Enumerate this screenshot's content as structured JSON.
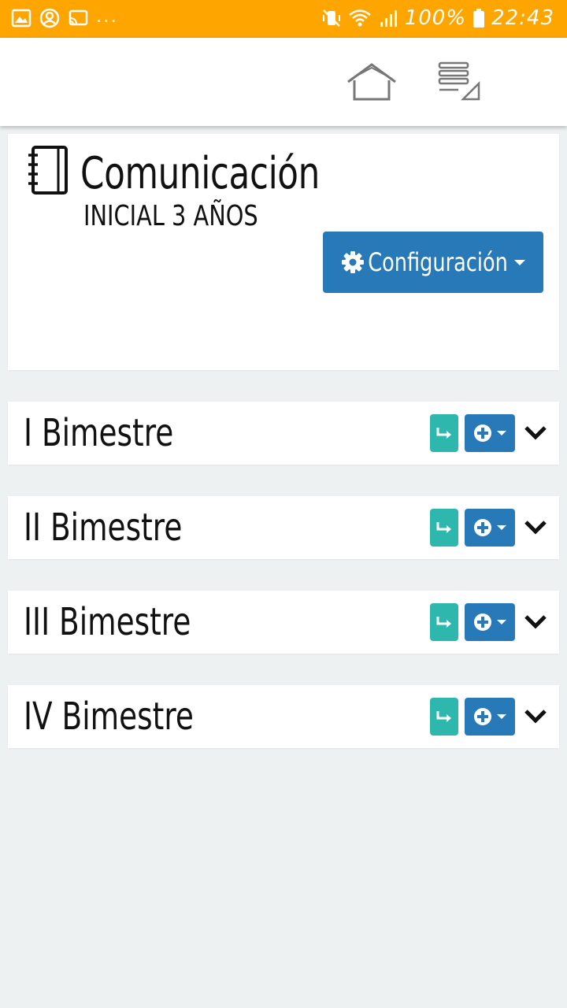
{
  "status_bar": {
    "left_icons": [
      "image-icon",
      "account-circle-icon",
      "cast-icon"
    ],
    "overflow": "...",
    "right_icons": [
      "vibrate-mute-icon",
      "wifi-icon",
      "signal-icon"
    ],
    "battery": "100%",
    "time": "22:43",
    "bg_color": "#ffa500"
  },
  "appbar": {
    "icons": [
      "home-icon",
      "menu-list-icon"
    ]
  },
  "course": {
    "icon": "notebook-icon",
    "title": "Comunicación",
    "subtitle": "INICIAL 3 AÑOS",
    "config_button": {
      "label": "Configuración",
      "icon": "gear-icon",
      "color": "#2779b8"
    }
  },
  "bimestres": [
    {
      "label": "I Bimestre"
    },
    {
      "label": "II Bimestre"
    },
    {
      "label": "III Bimestre"
    },
    {
      "label": "IV Bimestre"
    }
  ],
  "panel_actions": {
    "go_button_icon": "arrow-return-icon",
    "go_button_color": "#2db7ad",
    "add_button_icon": "plus-circle-icon",
    "add_button_color": "#2779b8",
    "expand_icon": "chevron-down-icon"
  }
}
